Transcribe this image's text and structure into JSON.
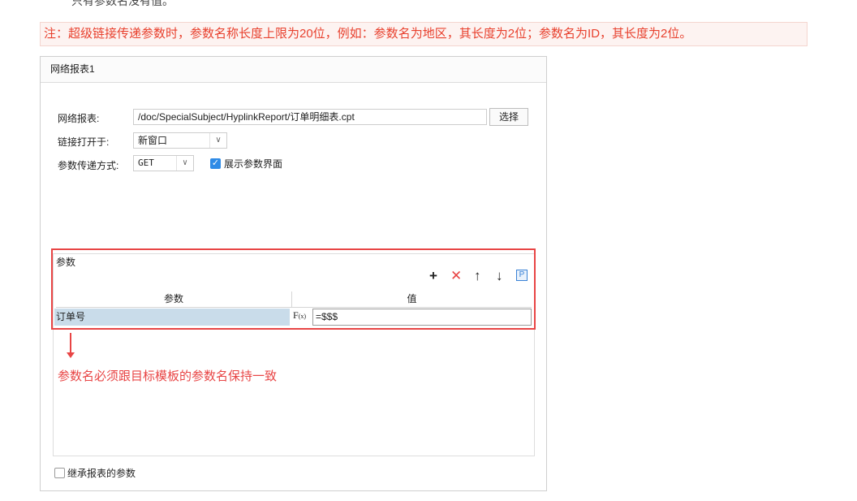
{
  "top_text": "只有参数名没有值。",
  "note": "注：超级链接传递参数时，参数名称长度上限为20位，例如：参数名为地区，其长度为2位；参数名为ID，其长度为2位。",
  "dialog": {
    "title": "网络报表1",
    "report_label": "网络报表:",
    "report_path": "/doc/SpecialSubject/HyplinkReport/订单明细表.cpt",
    "choose_button": "选择",
    "open_in_label": "链接打开于:",
    "open_in_value": "新窗口",
    "method_label": "参数传递方式:",
    "method_value": "GET",
    "show_params_label": "展示参数界面",
    "params_group_title": "参数",
    "toolbar": {
      "add": "+",
      "delete": "✕",
      "up": "↑",
      "down": "↓",
      "p": "P"
    },
    "table": {
      "headers": [
        "参数",
        "值"
      ],
      "rows": [
        {
          "param": "订单号",
          "value": "=$$$"
        }
      ]
    },
    "inherit_label": "继承报表的参数"
  },
  "annotation": "参数名必须跟目标模板的参数名保持一致",
  "colors": {
    "accent_red": "#e84545",
    "checkbox_blue": "#2f8be6",
    "selected_row": "#c9dcea"
  }
}
